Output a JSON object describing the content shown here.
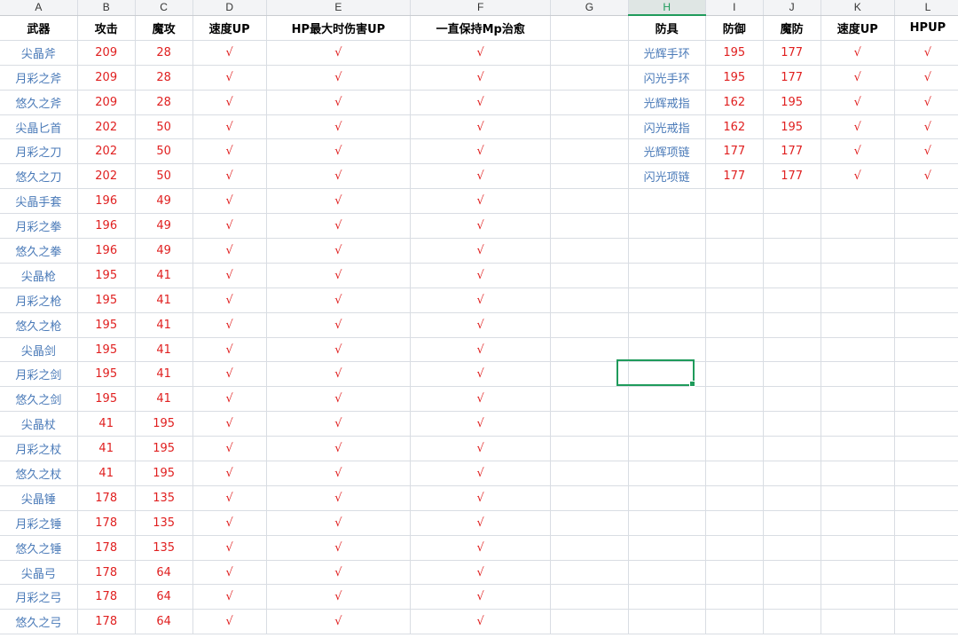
{
  "column_letters": [
    "A",
    "B",
    "C",
    "D",
    "E",
    "F",
    "G",
    "H",
    "I",
    "J",
    "K",
    "L"
  ],
  "selected_column": "H",
  "weapon_headers": [
    "武器",
    "攻击",
    "魔攻",
    "速度UP",
    "HP最大时伤害UP",
    "一直保持Mp治愈"
  ],
  "armor_headers": [
    "防具",
    "防御",
    "魔防",
    "速度UP",
    "HPUP"
  ],
  "check_mark": "√",
  "weapons": [
    [
      "尖晶斧",
      "209",
      "28"
    ],
    [
      "月彩之斧",
      "209",
      "28"
    ],
    [
      "悠久之斧",
      "209",
      "28"
    ],
    [
      "尖晶匕首",
      "202",
      "50"
    ],
    [
      "月彩之刀",
      "202",
      "50"
    ],
    [
      "悠久之刀",
      "202",
      "50"
    ],
    [
      "尖晶手套",
      "196",
      "49"
    ],
    [
      "月彩之拳",
      "196",
      "49"
    ],
    [
      "悠久之拳",
      "196",
      "49"
    ],
    [
      "尖晶枪",
      "195",
      "41"
    ],
    [
      "月彩之枪",
      "195",
      "41"
    ],
    [
      "悠久之枪",
      "195",
      "41"
    ],
    [
      "尖晶剑",
      "195",
      "41"
    ],
    [
      "月彩之剑",
      "195",
      "41"
    ],
    [
      "悠久之剑",
      "195",
      "41"
    ],
    [
      "尖晶杖",
      "41",
      "195"
    ],
    [
      "月彩之杖",
      "41",
      "195"
    ],
    [
      "悠久之杖",
      "41",
      "195"
    ],
    [
      "尖晶锤",
      "178",
      "135"
    ],
    [
      "月彩之锤",
      "178",
      "135"
    ],
    [
      "悠久之锤",
      "178",
      "135"
    ],
    [
      "尖晶弓",
      "178",
      "64"
    ],
    [
      "月彩之弓",
      "178",
      "64"
    ],
    [
      "悠久之弓",
      "178",
      "64"
    ]
  ],
  "armors": [
    [
      "光辉手环",
      "195",
      "177"
    ],
    [
      "闪光手环",
      "195",
      "177"
    ],
    [
      "光辉戒指",
      "162",
      "195"
    ],
    [
      "闪光戒指",
      "162",
      "195"
    ],
    [
      "光辉项链",
      "177",
      "177"
    ],
    [
      "闪光项链",
      "177",
      "177"
    ]
  ],
  "colors": {
    "name_text": "#4a7ab8",
    "value_text": "#e02020",
    "selection": "#1f9b5b",
    "grid": "#d9dde3"
  }
}
